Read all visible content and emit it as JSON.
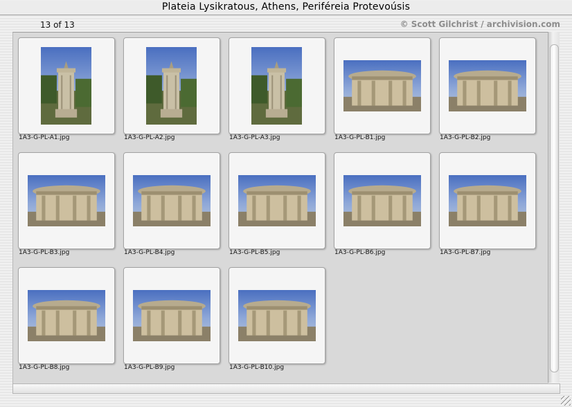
{
  "window": {
    "title": "Plateia Lysikratous, Athens, Periféreia Protevoúsis",
    "counter": "13 of 13",
    "credit": "© Scott Gilchrist / archivision.com"
  },
  "thumbnails": [
    {
      "filename": "1A3-G-PL-A1.jpg",
      "orientation": "portrait"
    },
    {
      "filename": "1A3-G-PL-A2.jpg",
      "orientation": "portrait"
    },
    {
      "filename": "1A3-G-PL-A3.jpg",
      "orientation": "portrait"
    },
    {
      "filename": "1A3-G-PL-B1.jpg",
      "orientation": "landscape"
    },
    {
      "filename": "1A3-G-PL-B2.jpg",
      "orientation": "landscape"
    },
    {
      "filename": "1A3-G-PL-B3.jpg",
      "orientation": "landscape"
    },
    {
      "filename": "1A3-G-PL-B4.jpg",
      "orientation": "landscape"
    },
    {
      "filename": "1A3-G-PL-B5.jpg",
      "orientation": "landscape"
    },
    {
      "filename": "1A3-G-PL-B6.jpg",
      "orientation": "landscape"
    },
    {
      "filename": "1A3-G-PL-B7.jpg",
      "orientation": "landscape"
    },
    {
      "filename": "1A3-G-PL-B8.jpg",
      "orientation": "landscape"
    },
    {
      "filename": "1A3-G-PL-B9.jpg",
      "orientation": "landscape"
    },
    {
      "filename": "1A3-G-PL-B10.jpg",
      "orientation": "landscape"
    }
  ]
}
